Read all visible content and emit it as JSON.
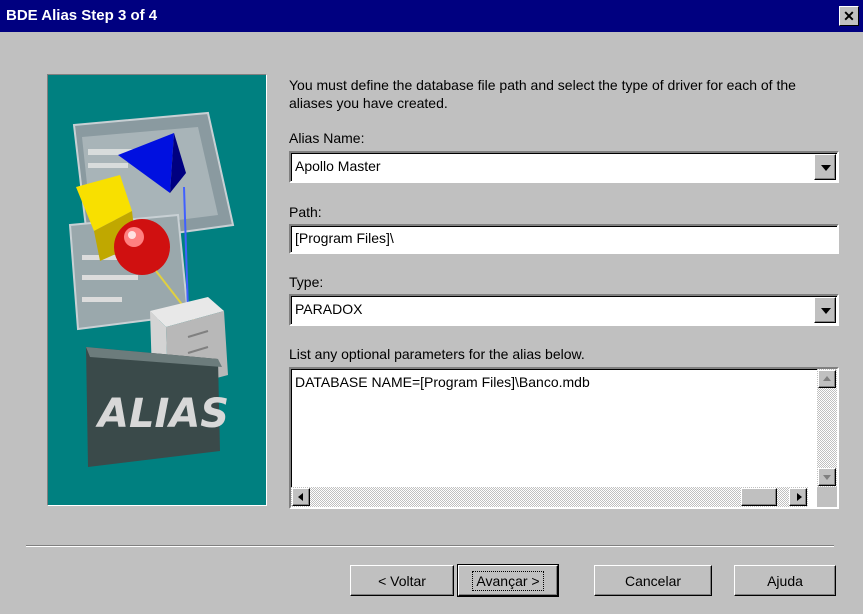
{
  "window": {
    "title": "BDE Alias Step 3 of 4",
    "close_glyph": "✕"
  },
  "illustration": {
    "logo_text": "ALIAS"
  },
  "intro_text": "You must define the database file path and select the type of driver for each of the aliases you have created.",
  "alias_name": {
    "label": "Alias Name:",
    "value": "Apollo Master"
  },
  "path": {
    "label": "Path:",
    "value": "[Program Files]\\"
  },
  "type": {
    "label": "Type:",
    "value": "PARADOX"
  },
  "parameters": {
    "label": "List any optional parameters for the alias below.",
    "value": "DATABASE NAME=[Program Files]\\Banco.mdb"
  },
  "buttons": {
    "back": "< Voltar",
    "next": "Avançar >",
    "cancel": "Cancelar",
    "help": "Ajuda"
  },
  "colors": {
    "titlebar": "#000080",
    "face": "#c0c0c0",
    "illustration_bg": "#008080"
  }
}
